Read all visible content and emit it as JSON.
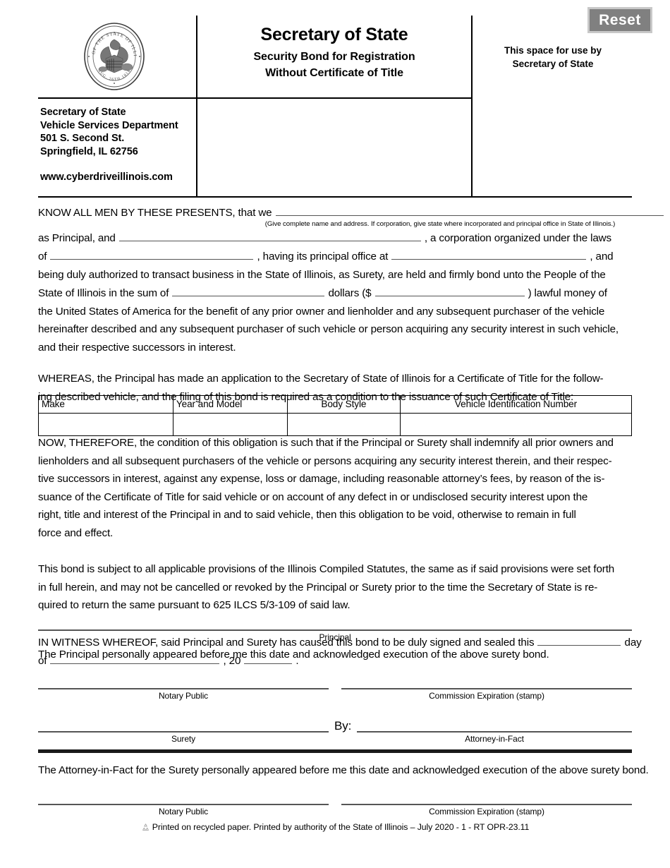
{
  "document": {
    "title": "Secretary of State",
    "subtitle_line1": "Security Bond for Registration",
    "subtitle_line2": "Without Certificate of Title"
  },
  "reset_button": {
    "label": "Reset"
  },
  "header": {
    "seal_alt": "Seal of the State of Illinois",
    "sos_space_line1": "This space for use by",
    "sos_space_line2": "Secretary of State",
    "address": {
      "line1": "Secretary of State",
      "line2": "Vehicle Services Department",
      "line3": "501 S. Second St.",
      "line4": "Springfield, IL 62756",
      "website": "www.cyberdriveillinois.com"
    }
  },
  "body": {
    "p1_l1_a": "KNOW ALL MEN BY THESE PRESENTS, that we",
    "p1_hint": "(Give complete name and address. If corporation, give state where incorporated and principal office in State of Illinois.)",
    "p1_l2_a": "as Principal, and",
    "p1_l2_b": ", a corporation organized under the laws",
    "p1_l3_a": "of",
    "p1_l3_b": ", having its principal office at",
    "p1_l3_c": ", and",
    "p1_l4": "being duly authorized to transact business in the State of Illinois, as Surety, are held and firmly bond unto the People of the",
    "p1_l5_a": "State of Illinois in the sum of",
    "p1_l5_b": "dollars ($",
    "p1_l5_c": ") lawful money of",
    "p1_l6": "the United States of America for the benefit of any prior owner and lienholder and any subsequent purchaser of the vehicle",
    "p1_l7": "hereinafter described and any subsequent purchaser of such vehicle or person acquiring any security interest in such vehicle,",
    "p1_l8": "and their respective successors in interest.",
    "p2_l1": "WHEREAS, the Principal has made an application to the Secretary of State of Illinois for a Certificate of Title for the follow-",
    "p2_l2": "ing described vehicle, and the filing of this bond is required as a condition to the issuance of such Certificate of Title:",
    "p3_l1": "NOW, THEREFORE, the condition of this obligation is such that if the Principal or Surety shall indemnify all prior owners and",
    "p3_l2": "lienholders and all subsequent purchasers of the vehicle or persons acquiring any security interest therein, and their respec-",
    "p3_l3": "tive successors in interest, against any expense, loss or damage, including reasonable attorney’s fees, by reason of the is-",
    "p3_l4": "suance of the Certificate of Title for said vehicle or on account of any defect in or undisclosed security interest upon the",
    "p3_l5": "right, title and interest of the Principal in and to said vehicle, then this obligation to be void, otherwise to remain in full",
    "p3_l6": "force and effect.",
    "p4_l1": "This bond is subject to all applicable provisions of the Illinois Compiled Statutes, the same as if said provisions were set forth",
    "p4_l2": "in full herein, and may not be cancelled or revoked by the Principal or Surety prior to the time the Secretary of State is re-",
    "p4_l3": "quired to return the same pursuant to 625 ILCS 5/3-109 of said law.",
    "p5_l1_a": "IN WITNESS WHEREOF, said Principal and Surety has caused this bond to be duly signed and sealed this",
    "p5_l1_b": "day",
    "p5_l2_a": "of",
    "p5_l2_b": ", 20",
    "p5_l2_c": "."
  },
  "vehicle_table": {
    "headers": [
      "Make",
      "Year and Model",
      "Body Style",
      "Vehicle Identification Number"
    ],
    "rows": [
      [
        "",
        "",
        "",
        ""
      ]
    ]
  },
  "signatures": {
    "principal_label": "Principal",
    "principal_statement": "The Principal personally appeared before me this date and acknowledged execution of the above surety bond.",
    "notary_label_1": "Notary Public",
    "commission_label_1": "Commission Expiration (stamp)",
    "surety_label": "Surety",
    "by_label": "By:",
    "attorney_label": "Attorney-in-Fact",
    "attorney_statement": "The Attorney-in-Fact for the Surety personally appeared before me this date and acknowledged execution of the above surety bond.",
    "notary_label_2": "Notary Public",
    "commission_label_2": "Commission Expiration (stamp)"
  },
  "footer": {
    "icon": "recycle-icon",
    "text": "Printed on recycled paper. Printed by authority of the State of Illinois – July 2020 - 1 - RT OPR-23.11"
  },
  "colors": {
    "reset_bg": "#808080",
    "reset_border": "#c8c8c8",
    "rule": "#555555",
    "ink": "#000000"
  }
}
